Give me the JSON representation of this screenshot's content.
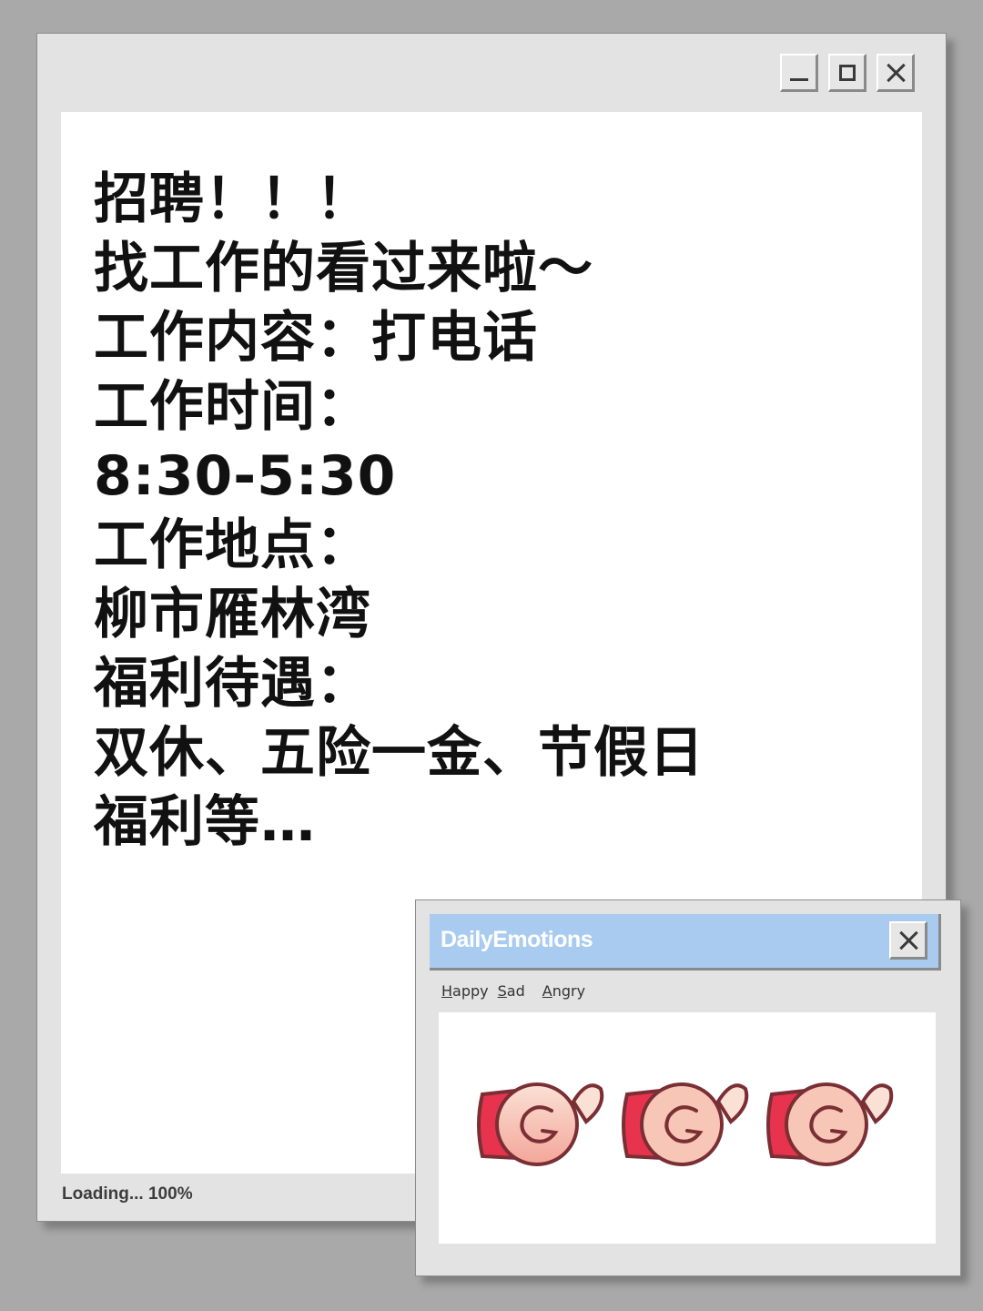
{
  "main_window": {
    "controls": [
      "minimize",
      "maximize",
      "close"
    ],
    "lines": [
      "招聘！！！",
      "找工作的看过来啦～",
      "工作内容：打电话",
      "工作时间：",
      "8:30-5:30",
      "工作地点：",
      "柳市雁林湾",
      "福利待遇：",
      "双休、五险一金、节假日",
      "福利等…"
    ],
    "status": "Loading... 100%"
  },
  "popup": {
    "title": "DailyEmotions",
    "menu": [
      {
        "accel": "H",
        "rest": "appy"
      },
      {
        "accel": "S",
        "rest": "ad"
      },
      {
        "accel": "A",
        "rest": "ngry"
      }
    ],
    "icons": [
      "curled-hand-icon",
      "curled-hand-icon",
      "curled-hand-icon"
    ],
    "colors": {
      "titlebar": "#a9cbf0",
      "emoji_light": "#fbe1d5",
      "emoji_mid": "#f3a699",
      "emoji_dark": "#e8334f",
      "emoji_outline": "#7a2f35"
    }
  }
}
